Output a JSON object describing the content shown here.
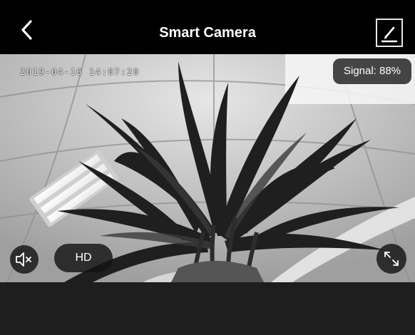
{
  "header": {
    "title": "Smart Camera",
    "back_icon": "chevron-left-icon",
    "edit_icon": "pencil-icon"
  },
  "video": {
    "timestamp": "2019-04-16 14:07:20",
    "signal_label": "Signal: 88%",
    "signal_strength_percent": 88,
    "quality_label": "HD",
    "mute_icon": "speaker-muted-icon",
    "fullscreen_icon": "expand-icon"
  },
  "colors": {
    "background": "#000000",
    "overlay": "#141414",
    "text": "#ffffff",
    "bottom_panel": "#1e1e1e"
  }
}
